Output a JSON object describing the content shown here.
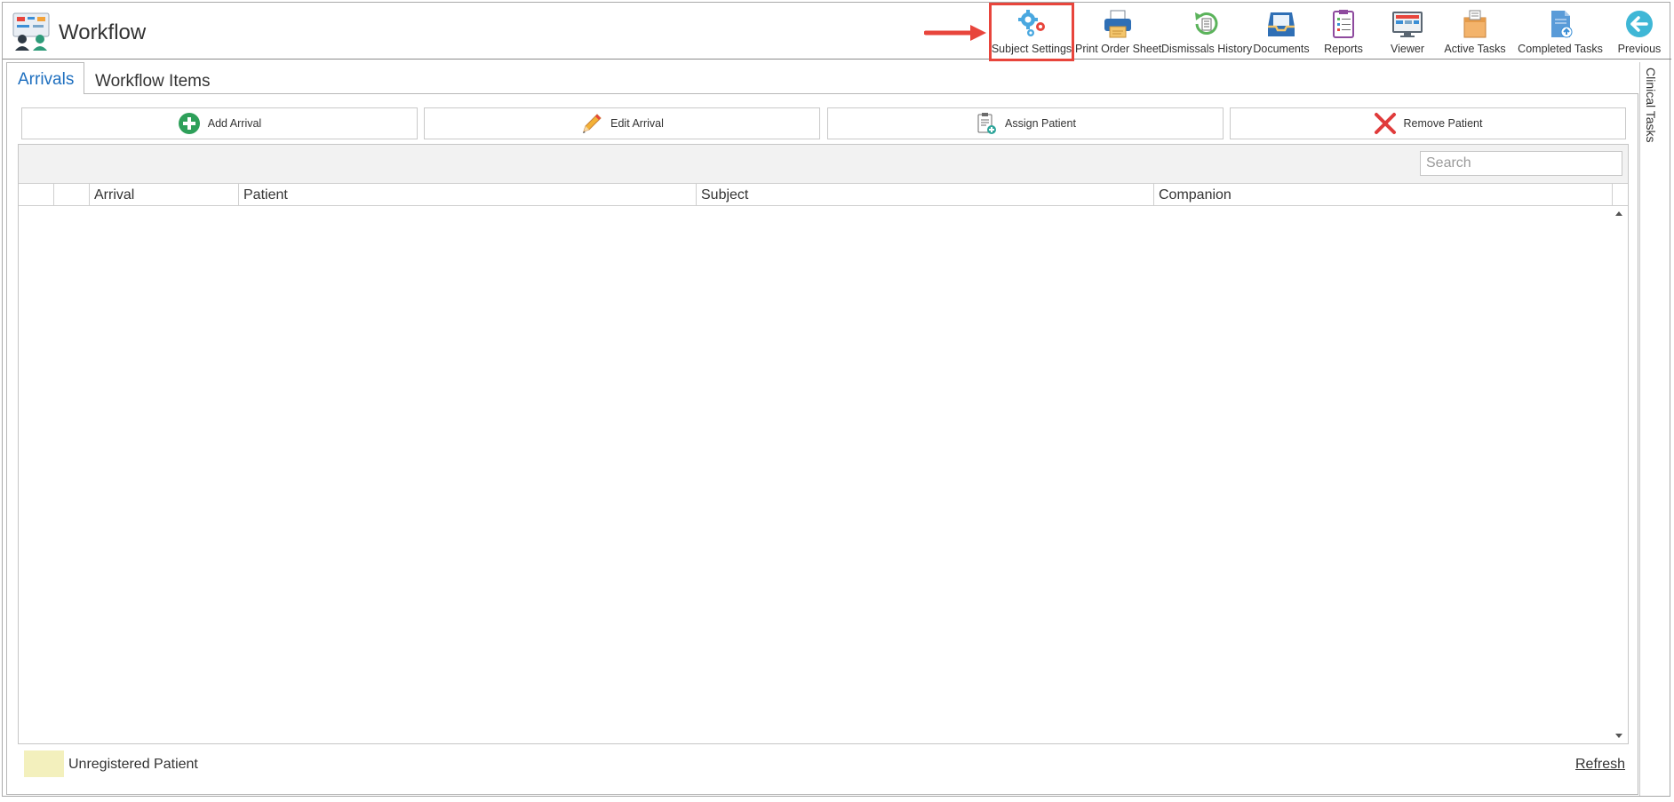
{
  "app": {
    "title": "Workflow"
  },
  "toolbar": {
    "items": [
      {
        "label": "Subject Settings",
        "icon": "gears-icon"
      },
      {
        "label": "Print Order Sheet",
        "icon": "printer-icon"
      },
      {
        "label": "Dismissals History",
        "icon": "history-icon"
      },
      {
        "label": "Documents",
        "icon": "inbox-tray-icon"
      },
      {
        "label": "Reports",
        "icon": "clipboard-list-icon"
      },
      {
        "label": "Viewer",
        "icon": "monitor-icon"
      },
      {
        "label": "Active Tasks",
        "icon": "task-box-icon"
      },
      {
        "label": "Completed Tasks",
        "icon": "completed-document-icon"
      },
      {
        "label": "Previous",
        "icon": "back-arrow-icon"
      }
    ],
    "highlighted": "Subject Settings",
    "highlight_color": "#e8453c"
  },
  "tabs": [
    {
      "label": "Arrivals",
      "active": true
    },
    {
      "label": "Workflow Items",
      "active": false
    }
  ],
  "side_panel": {
    "label": "Clinical Tasks"
  },
  "actions": [
    {
      "label": "Add Arrival",
      "icon": "plus-circle-icon"
    },
    {
      "label": "Edit Arrival",
      "icon": "pencil-icon"
    },
    {
      "label": "Assign Patient",
      "icon": "clipboard-add-icon"
    },
    {
      "label": "Remove Patient",
      "icon": "red-x-icon"
    }
  ],
  "grid": {
    "search_placeholder": "Search",
    "columns": [
      "",
      "",
      "Arrival",
      "Patient",
      "Subject",
      "Companion"
    ],
    "rows": []
  },
  "legend": {
    "label": "Unregistered Patient",
    "color": "#f3f0bd"
  },
  "refresh_label": "Refresh",
  "colors": {
    "accent": "#1e6fbf",
    "highlight": "#e8453c"
  }
}
